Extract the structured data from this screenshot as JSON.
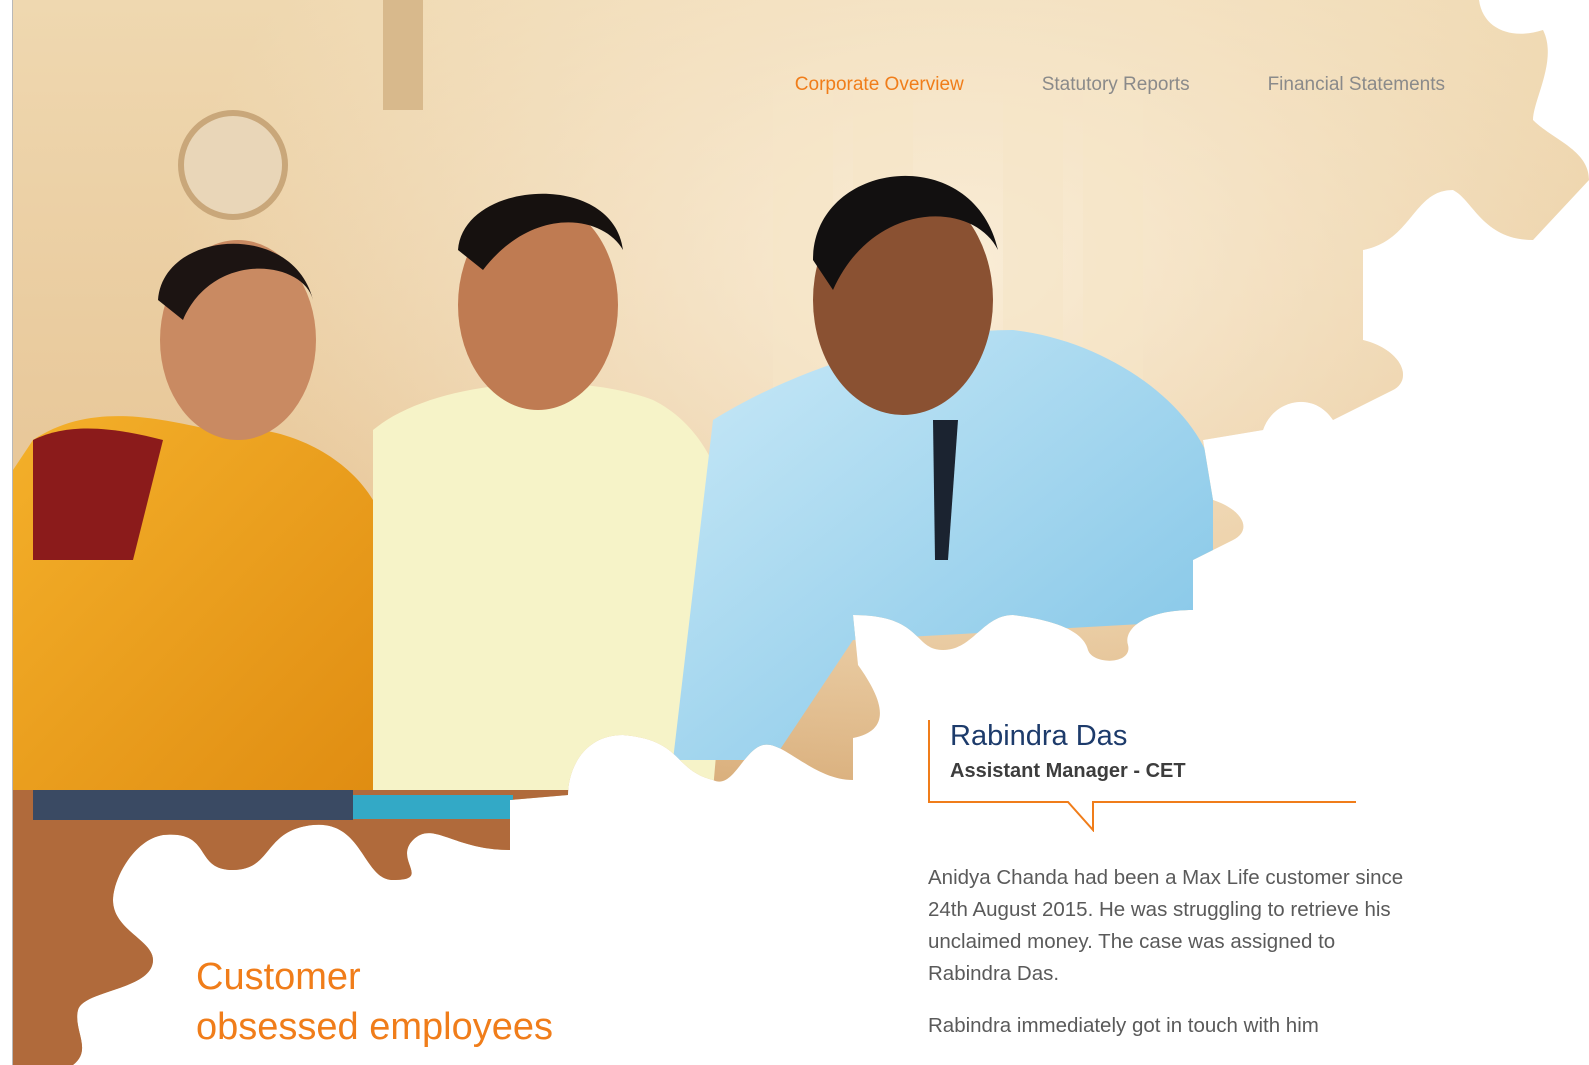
{
  "nav": {
    "items": [
      {
        "label": "Corporate Overview",
        "active": true
      },
      {
        "label": "Statutory Reports",
        "active": false
      },
      {
        "label": "Financial Statements",
        "active": false
      }
    ]
  },
  "profile": {
    "name": "Rabindra Das",
    "role": "Assistant Manager - CET"
  },
  "story": {
    "paragraphs": [
      "Anidya Chanda had been a Max Life customer since 24th August 2015. He was struggling to retrieve his unclaimed money. The case was assigned to Rabindra Das.",
      "Rabindra immediately got in touch with him"
    ]
  },
  "headline": {
    "line1": "Customer",
    "line2": "obsessed employees"
  },
  "colors": {
    "accent": "#f07d1a",
    "name": "#1d3b6b",
    "body": "#5a5a5a",
    "nav": "#8a8a8a"
  },
  "image": {
    "description_icon": "family-meeting-photo"
  }
}
